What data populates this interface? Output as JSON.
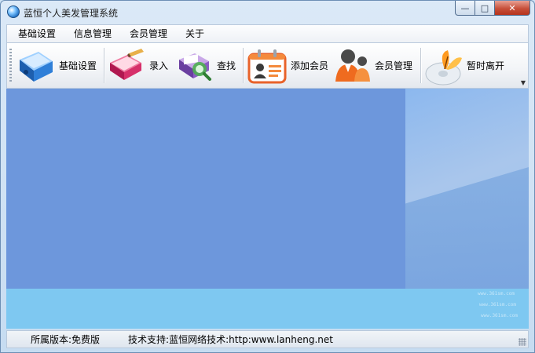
{
  "window": {
    "title": "蓝恒个人美发管理系统"
  },
  "window_controls": {
    "minimize": "—",
    "maximize": "□",
    "close": "✕"
  },
  "menu": [
    "基础设置",
    "信息管理",
    "会员管理",
    "关于"
  ],
  "toolbar": [
    {
      "label": "基础设置",
      "icon": "blue-binder-icon"
    },
    {
      "label": "录入",
      "icon": "red-book-pencil-icon"
    },
    {
      "label": "查找",
      "icon": "clipboard-search-icon"
    },
    {
      "label": "添加会员",
      "icon": "member-card-icon"
    },
    {
      "label": "会员管理",
      "icon": "members-group-icon"
    },
    {
      "label": "暂时离开",
      "icon": "butterfly-disc-icon"
    }
  ],
  "status": {
    "edition": "所属版本:免费版",
    "support": "技术支持:蓝恒网络技术:http:www.lanheng.net"
  },
  "colors": {
    "accent": "#6d97dc",
    "titlebar": "#dbe9f7",
    "close": "#c7503a"
  }
}
